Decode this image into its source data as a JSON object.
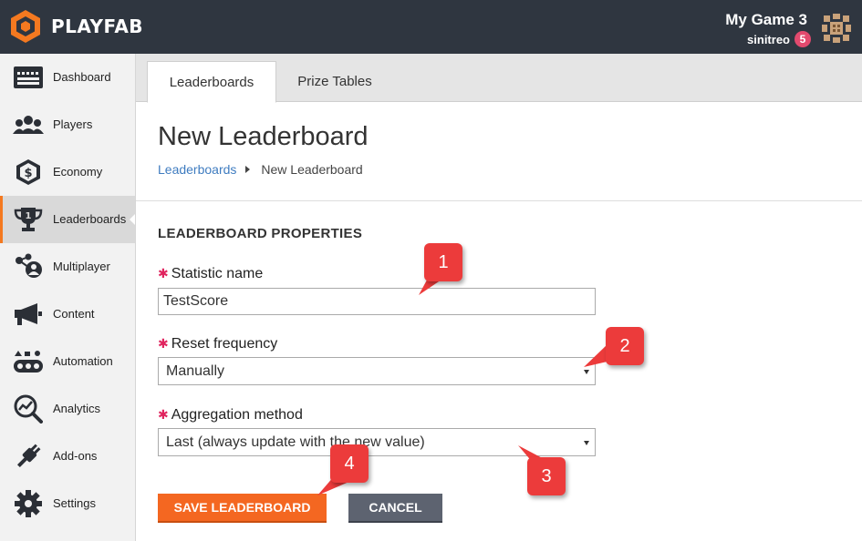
{
  "header": {
    "brand": "PLAYFAB",
    "game_title": "My Game 3",
    "username": "sinitreo",
    "notification_count": "5",
    "brand_color": "#f47920"
  },
  "sidebar": {
    "items": [
      {
        "label": "Dashboard",
        "icon": "dashboard-icon"
      },
      {
        "label": "Players",
        "icon": "players-icon"
      },
      {
        "label": "Economy",
        "icon": "economy-icon"
      },
      {
        "label": "Leaderboards",
        "icon": "trophy-icon",
        "active": true
      },
      {
        "label": "Multiplayer",
        "icon": "multiplayer-icon"
      },
      {
        "label": "Content",
        "icon": "megaphone-icon"
      },
      {
        "label": "Automation",
        "icon": "automation-icon"
      },
      {
        "label": "Analytics",
        "icon": "analytics-icon"
      },
      {
        "label": "Add-ons",
        "icon": "plug-icon"
      },
      {
        "label": "Settings",
        "icon": "gear-icon"
      }
    ]
  },
  "tabs": [
    {
      "label": "Leaderboards",
      "active": true
    },
    {
      "label": "Prize Tables",
      "active": false
    }
  ],
  "main": {
    "page_title": "New Leaderboard",
    "breadcrumb": {
      "parent": "Leaderboards",
      "current": "New Leaderboard"
    },
    "section_title": "LEADERBOARD PROPERTIES",
    "fields": {
      "statistic_name": {
        "label": "Statistic name",
        "value": "TestScore"
      },
      "reset_frequency": {
        "label": "Reset frequency",
        "value": "Manually"
      },
      "aggregation_method": {
        "label": "Aggregation method",
        "value": "Last (always update with the new value)"
      }
    },
    "buttons": {
      "save": "SAVE LEADERBOARD",
      "cancel": "CANCEL"
    }
  },
  "callouts": [
    "1",
    "2",
    "3",
    "4"
  ],
  "colors": {
    "header_bg": "#2f3640",
    "accent_orange": "#f46721",
    "cancel_gray": "#5d6370",
    "link_blue": "#3f7cc0",
    "required_red": "#e0245e",
    "callout_red": "#ec3b3b"
  }
}
